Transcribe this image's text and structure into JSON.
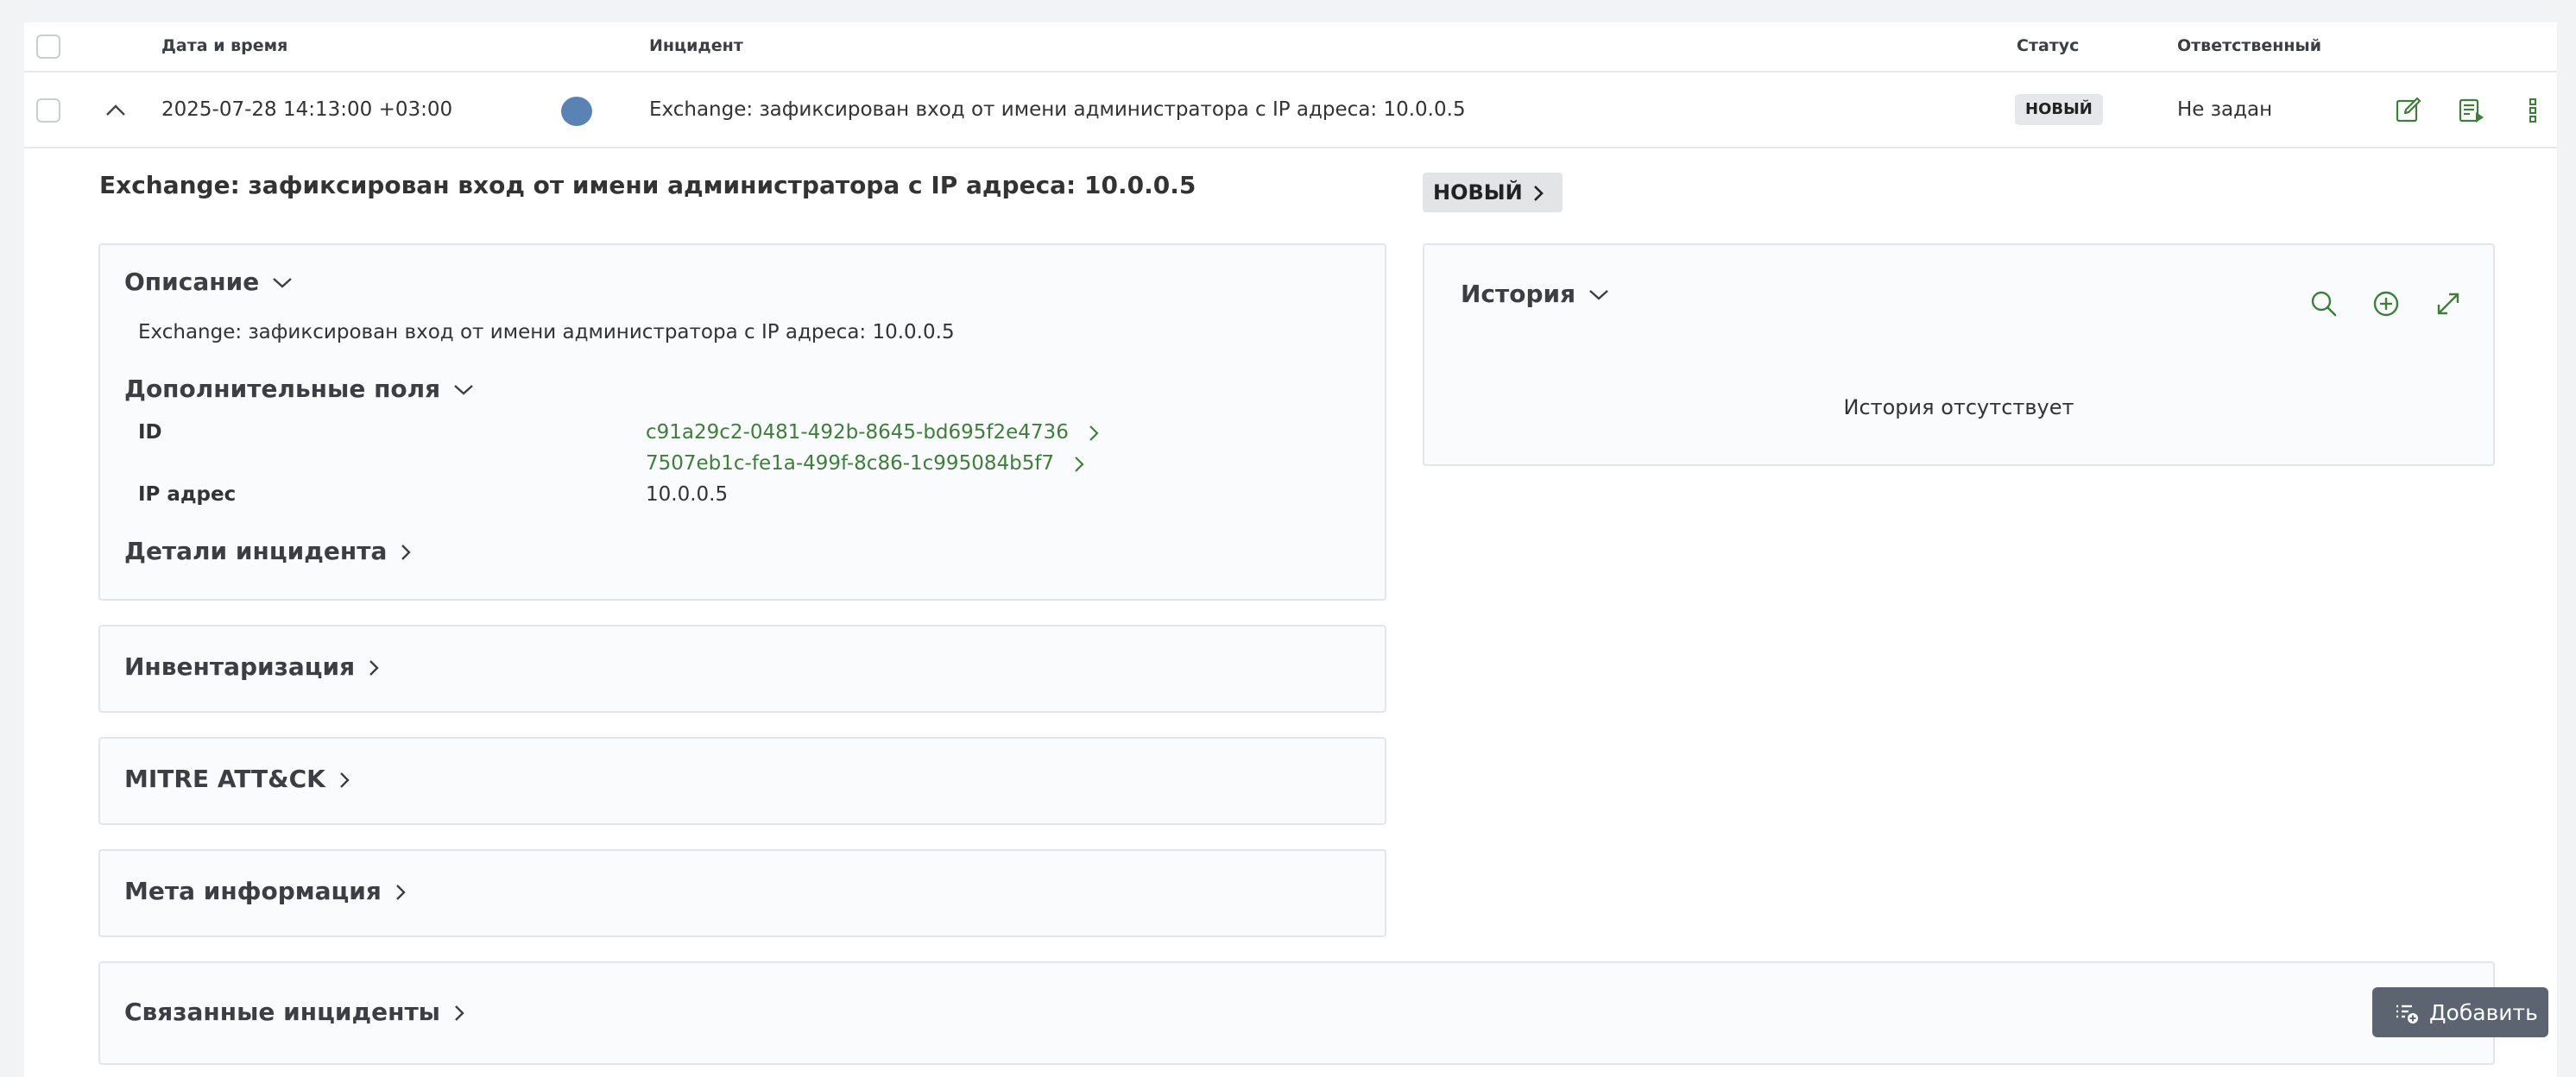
{
  "table": {
    "headers": {
      "datetime": "Дата и время",
      "incident": "Инцидент",
      "status": "Статус",
      "assignee": "Ответственный"
    },
    "row": {
      "datetime": "2025-07-28 14:13:00 +03:00",
      "severity_color": "#5b82b5",
      "incident": "Exchange: зафиксирован вход от имени администратора с IP адреса: 10.0.0.5",
      "status": "НОВЫЙ",
      "assignee": "Не задан",
      "actions": [
        "edit-icon",
        "playbook-icon",
        "more-vertical-icon"
      ]
    }
  },
  "detail": {
    "title": "Exchange: зафиксирован вход от имени администратора с IP адреса: 10.0.0.5",
    "status_chip": "НОВЫЙ",
    "description": {
      "title": "Описание",
      "text": "Exchange: зафиксирован вход от имени администратора с IP адреса: 10.0.0.5"
    },
    "extra_fields": {
      "title": "Дополнительные поля",
      "id_label": "ID",
      "ids": [
        "c91a29c2-0481-492b-8645-bd695f2e4736",
        "7507eb1c-fe1a-499f-8c86-1c995084b5f7"
      ],
      "ip_label": "IP адрес",
      "ip_value": "10.0.0.5"
    },
    "details_title": "Детали инцидента",
    "inventory_title": "Инвентаризация",
    "mitre_title": "MITRE ATT&CK",
    "meta_title": "Мета информация",
    "history": {
      "title": "История",
      "empty": "История отсутствует",
      "icons": [
        "search-icon",
        "add-circle-icon",
        "expand-icon"
      ]
    },
    "related": {
      "title": "Связанные инциденты",
      "add_label": "Добавить"
    }
  },
  "colors": {
    "accent_green": "#3f7d3c",
    "badge_bg": "#e6e7ea",
    "button_bg": "#5b6470"
  }
}
